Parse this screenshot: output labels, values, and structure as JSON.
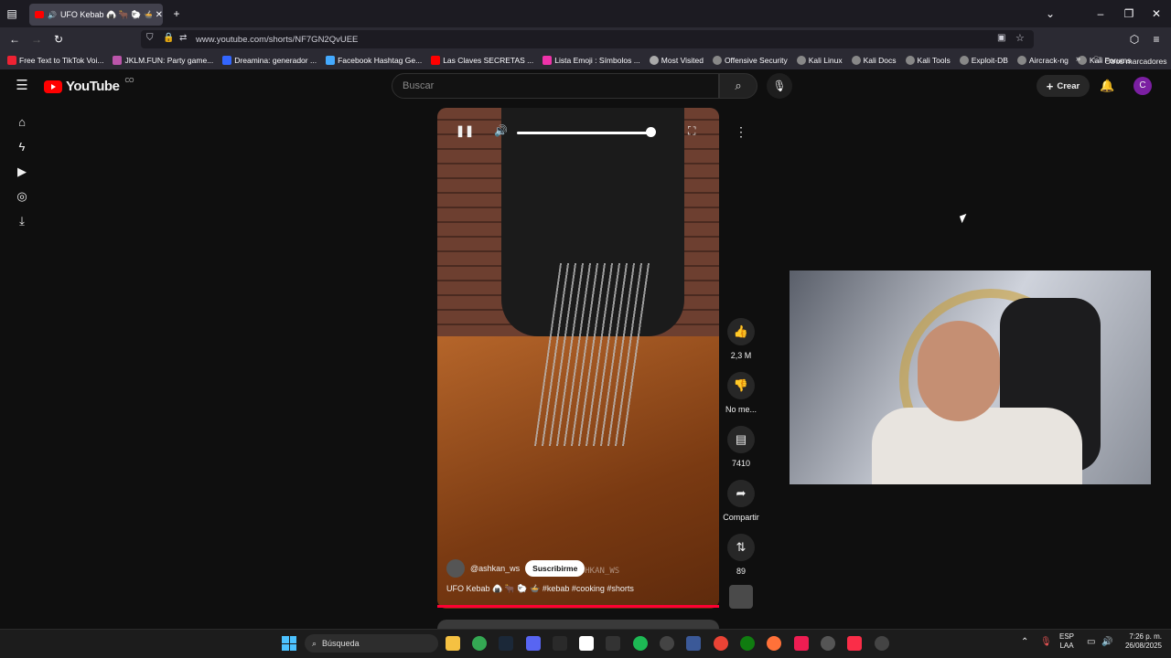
{
  "browser": {
    "tab_title": "UFO Kebab 🍙 🐂 🐑 🍲 #k",
    "url": "www.youtube.com/shorts/NF7GN2QvUEE",
    "bookmarks": [
      "Free Text to TikTok Voi...",
      "JKLM.FUN: Party game...",
      "Dreamina: generador ...",
      "Facebook Hashtag Ge...",
      "Las Claves SECRETAS ...",
      "Lista Emoji : Símbolos ...",
      "Most Visited",
      "Offensive Security",
      "Kali Linux",
      "Kali Docs",
      "Kali Tools",
      "Exploit-DB",
      "Aircrack-ng",
      "Kali Forums"
    ],
    "other_bookmarks": "Otros marcadores"
  },
  "youtube": {
    "logo_text": "YouTube",
    "country_code": "CO",
    "search_placeholder": "Buscar",
    "create_label": "Crear",
    "avatar_letter": "C"
  },
  "short": {
    "channel": "@ashkan_ws",
    "subscribe_label": "Suscribirme",
    "caption": "UFO Kebab 🍙 🐂 🐑 🍲 #kebab #cooking #shorts",
    "watermark": "@ASHKAN_WS",
    "volume_percent": 100,
    "likes": "2,3 M",
    "dislike_label": "No me...",
    "comments": "7410",
    "share_label": "Compartir",
    "remix_count": "89"
  },
  "taskbar": {
    "search_placeholder": "Búsqueda",
    "lang_line1": "ESP",
    "lang_line2": "LAA",
    "time": "7:26 p. m.",
    "date": "26/08/2025"
  },
  "colors": {
    "youtube_red": "#ff0000",
    "background": "#0f0f0f",
    "avatar": "#7b1fa2"
  }
}
